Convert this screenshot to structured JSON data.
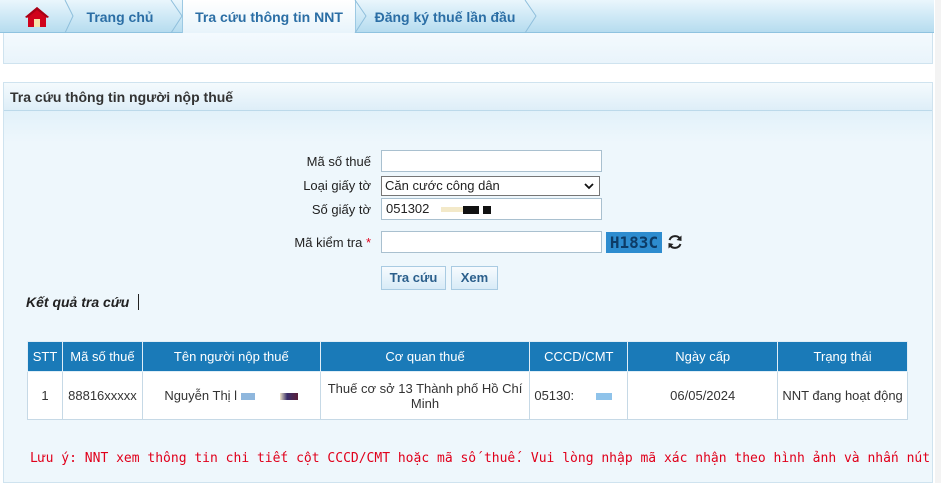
{
  "nav": {
    "home_icon": "home-icon",
    "tabs": [
      {
        "label": "Trang chủ",
        "active": false
      },
      {
        "label": "Tra cứu thông tin NNT",
        "active": true
      },
      {
        "label": "Đăng ký thuế lần đầu",
        "active": false
      }
    ]
  },
  "panel": {
    "title": "Tra cứu thông tin người nộp thuế"
  },
  "form": {
    "tax_code_label": "Mã số thuế",
    "tax_code_value": "",
    "doc_type_label": "Loại giấy tờ",
    "doc_type_value": "Căn cước công dân",
    "doc_number_label": "Số giấy tờ",
    "doc_number_value": "051302",
    "captcha_label": "Mã kiểm tra",
    "captcha_required": "*",
    "captcha_value": "",
    "captcha_text": "H183C",
    "search_button": "Tra cứu",
    "view_button": "Xem"
  },
  "results": {
    "title": "Kết quả tra cứu",
    "headers": [
      "STT",
      "Mã số thuế",
      "Tên người nộp thuế",
      "Cơ quan thuế",
      "CCCD/CMT",
      "Ngày cấp",
      "Trạng thái"
    ],
    "rows": [
      {
        "stt": "1",
        "tax_code": "88816xxxxx",
        "name": "Nguyễn Thị l",
        "agency": "Thuế cơ sở 13 Thành phố Hồ Chí Minh",
        "id_number": "05130:",
        "issue_date": "06/05/2024",
        "status": "NNT đang hoạt động"
      }
    ]
  },
  "note": "Lưu ý: NNT xem thông tin chi tiết cột CCCD/CMT hoặc mã số thuế. Vui lòng nhập mã xác nhận theo hình ảnh và nhấn nút \"Xem\"",
  "colors": {
    "table_header": "#1a7ab8",
    "note": "#e0001b",
    "accent": "#2b6ea5"
  }
}
